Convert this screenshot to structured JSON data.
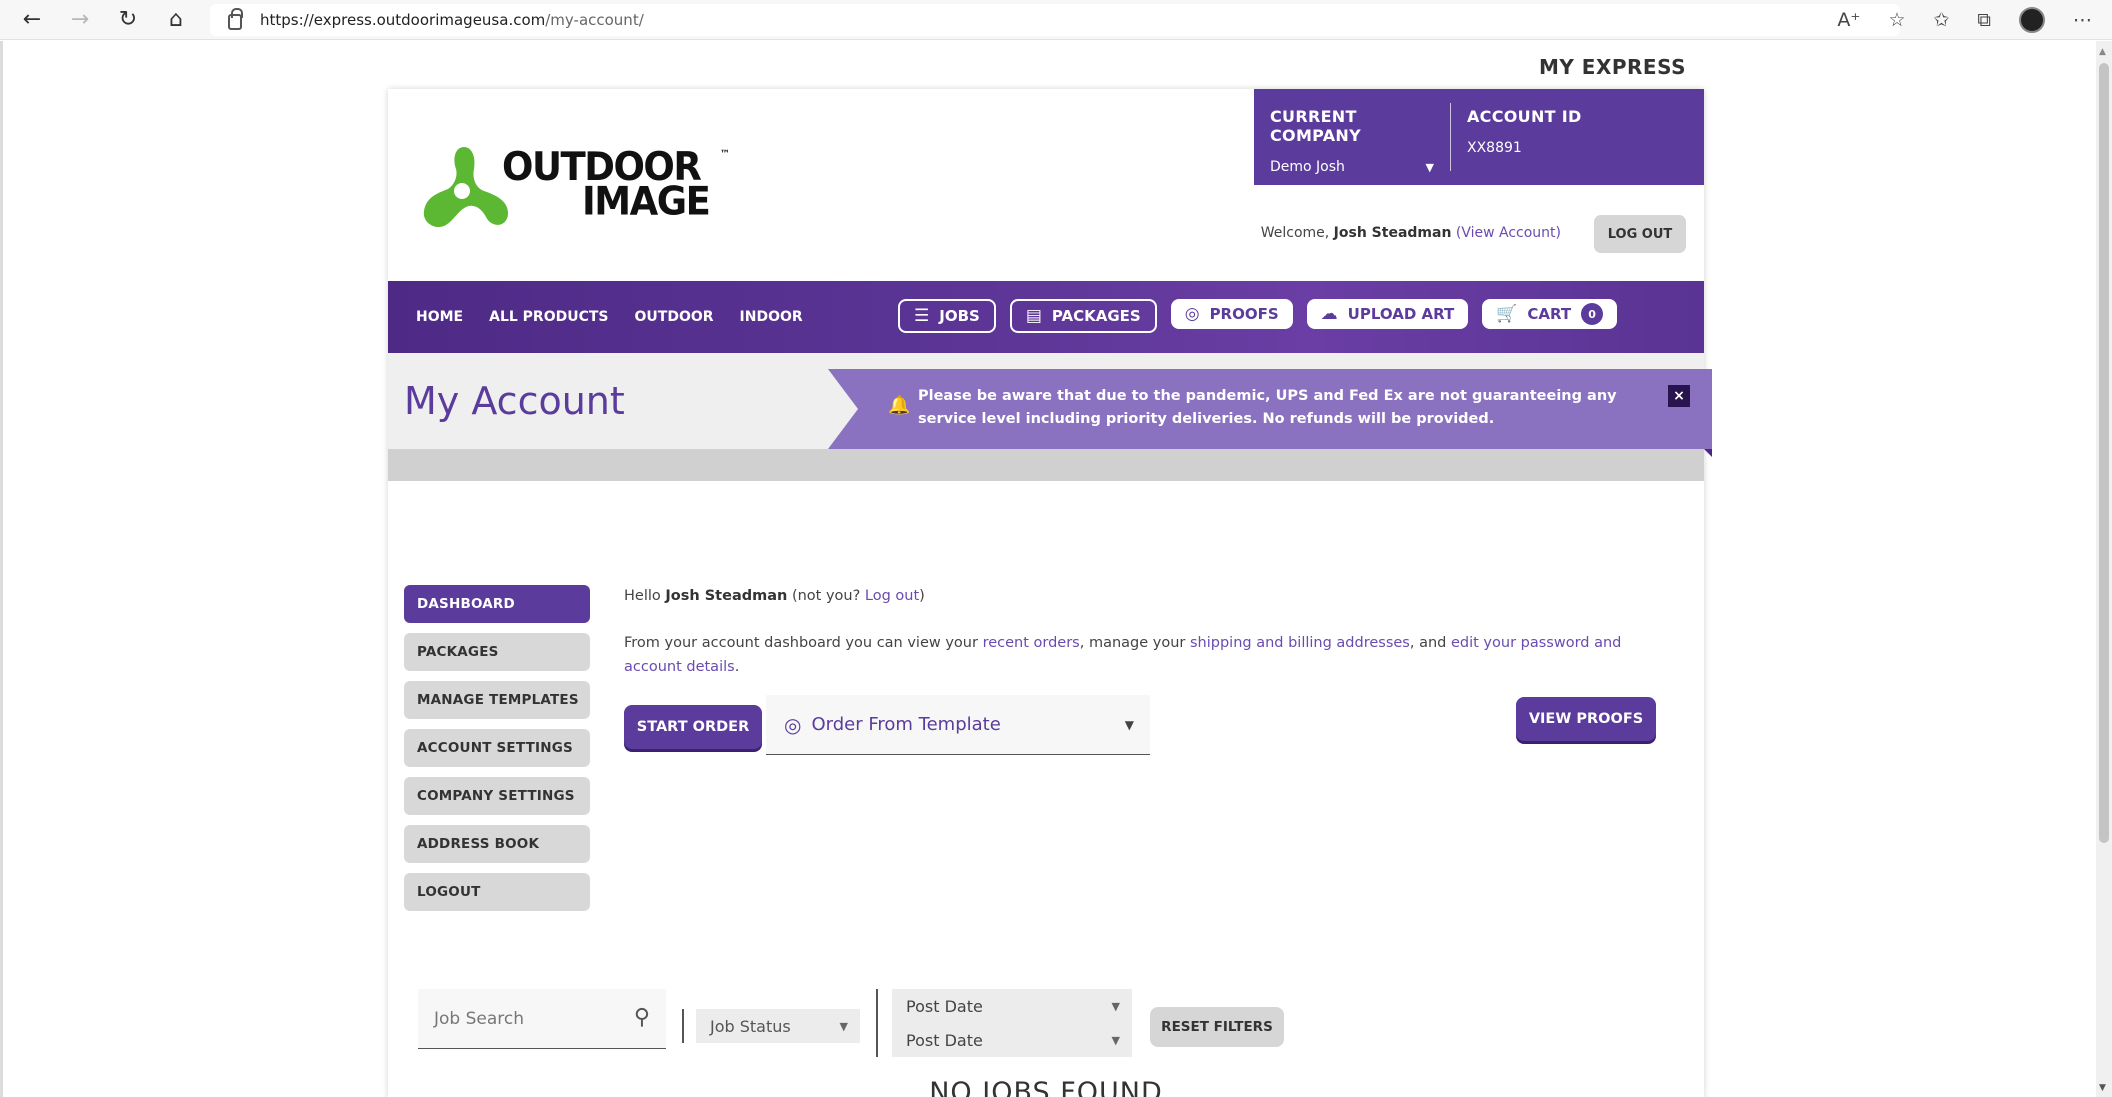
{
  "browser": {
    "url_host": "https://express.outdoorimageusa.com",
    "url_path": "/my-account/"
  },
  "header": {
    "my_express": "MY EXPRESS",
    "logo_line1": "OUTDOOR",
    "logo_line2": "IMAGE",
    "logo_tm": "™",
    "company_label": "CURRENT COMPANY",
    "company_value": "Demo Josh",
    "account_label": "ACCOUNT ID",
    "account_value": "XX8891",
    "welcome_prefix": "Welcome,",
    "welcome_name": "Josh Steadman",
    "view_account": "(View Account)",
    "logout_label": "LOG OUT"
  },
  "nav": {
    "links": [
      "HOME",
      "ALL PRODUCTS",
      "OUTDOOR",
      "INDOOR"
    ],
    "jobs": "JOBS",
    "packages": "PACKAGES",
    "proofs": "PROOFS",
    "upload_art": "UPLOAD ART",
    "cart": "CART",
    "cart_count": "0"
  },
  "title": {
    "page_title": "My Account",
    "alert_text": "Please be aware that due to the pandemic, UPS and Fed Ex are not guaranteeing any service level including priority deliveries. No refunds will be provided.",
    "alert_close": "×"
  },
  "sidebar": {
    "items": [
      "DASHBOARD",
      "PACKAGES",
      "MANAGE TEMPLATES",
      "ACCOUNT SETTINGS",
      "COMPANY SETTINGS",
      "ADDRESS BOOK",
      "LOGOUT"
    ]
  },
  "main": {
    "hello_prefix": "Hello",
    "hello_name": "Josh Steadman",
    "not_you": "(not you?",
    "log_out_link": "Log out",
    "not_you_close": ")",
    "intro_1": "From your account dashboard you can view your",
    "recent_orders": "recent orders",
    "intro_2": ", manage your",
    "addresses": "shipping and billing addresses",
    "intro_3": ", and",
    "edit_password": "edit your password and account details",
    "intro_4": ".",
    "start_order": "START ORDER",
    "template_select": "Order From Template",
    "view_proofs": "VIEW PROOFS"
  },
  "filters": {
    "job_search_placeholder": "Job Search",
    "job_status": "Job Status",
    "post_date_1": "Post Date",
    "post_date_2": "Post Date",
    "reset": "RESET FILTERS",
    "no_jobs": "NO JOBS FOUND"
  },
  "colors": {
    "brand_purple": "#5b3b9c",
    "alert_purple": "#8a72c0",
    "logo_green": "#5cb832"
  }
}
